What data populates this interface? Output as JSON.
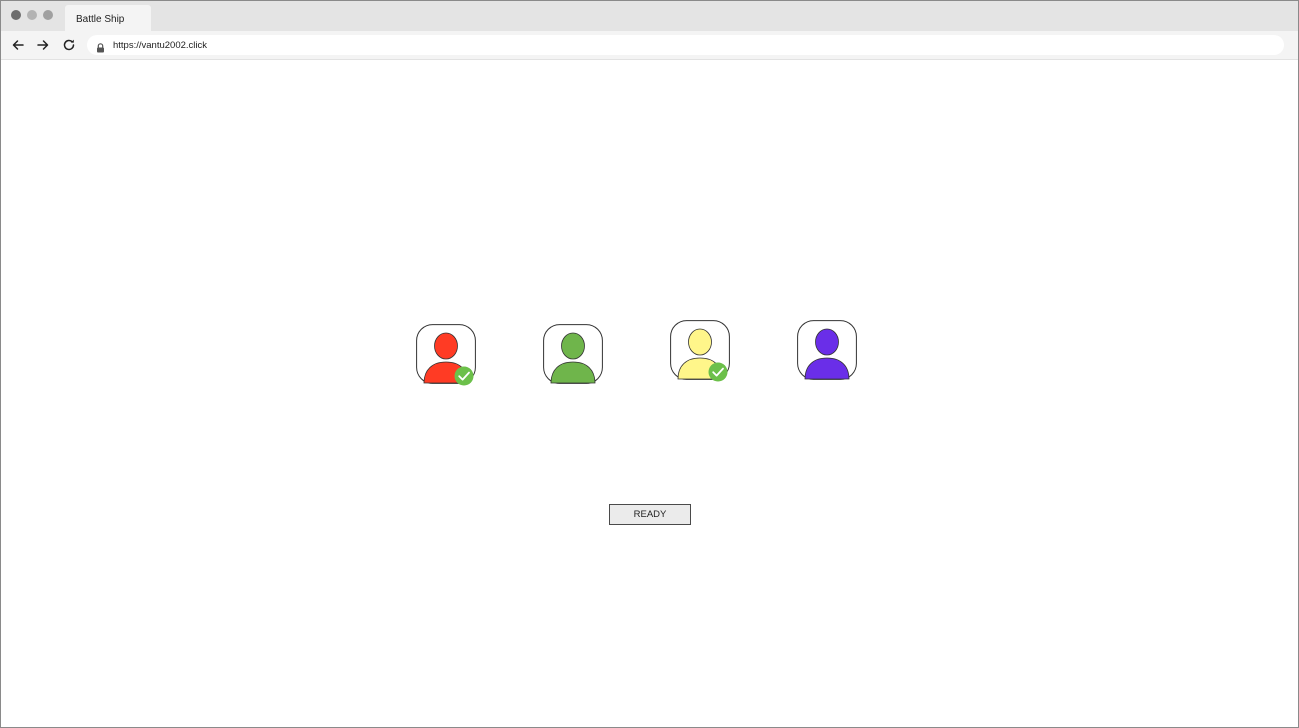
{
  "browser": {
    "tab_title": "Battle Ship",
    "url": "https://vantu2002.click",
    "icons": {
      "back": "arrow-left-icon",
      "forward": "arrow-right-icon",
      "reload": "reload-icon",
      "lock": "lock-icon"
    }
  },
  "lobby": {
    "players": [
      {
        "color": "#ff3b24",
        "ready": true
      },
      {
        "color": "#6fb54b",
        "ready": false
      },
      {
        "color": "#fff68a",
        "ready": true
      },
      {
        "color": "#6a2ee8",
        "ready": false
      }
    ],
    "ready_indicator_color": "#6cc04a",
    "ready_button_label": "READY"
  }
}
